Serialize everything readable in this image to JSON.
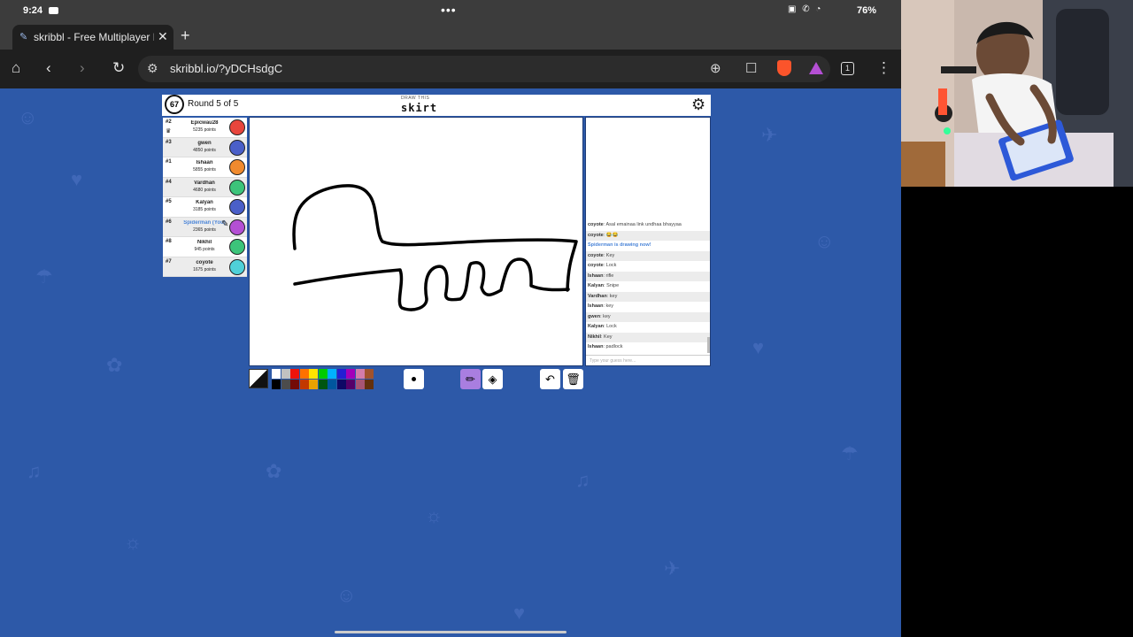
{
  "status": {
    "time": "9:24",
    "battery": "76%"
  },
  "browser": {
    "tab_title": "skribbl - Free Multiplayer Dra",
    "url": "skribbl.io/?yDCHsdgC",
    "tab_count": "1"
  },
  "game": {
    "timer": "67",
    "round": "Round 5 of 5",
    "draw_this": "DRAW THIS",
    "word": "skirt",
    "chat_placeholder": "Type your guess here...",
    "players": [
      {
        "rank": "#2",
        "name": "Epicwau28",
        "points": "5235 points",
        "avatar_color": "#e8453c",
        "crown": true,
        "highlight": false
      },
      {
        "rank": "#3",
        "name": "gwen",
        "points": "4850 points",
        "avatar_color": "#4a5fc8",
        "crown": false,
        "highlight": false
      },
      {
        "rank": "#1",
        "name": "Ishaan",
        "points": "5855 points",
        "avatar_color": "#f08a2e",
        "crown": false,
        "highlight": false
      },
      {
        "rank": "#4",
        "name": "Vardhan",
        "points": "4680 points",
        "avatar_color": "#3cc47a",
        "crown": false,
        "highlight": false
      },
      {
        "rank": "#5",
        "name": "Kalyan",
        "points": "3185 points",
        "avatar_color": "#4a5fc8",
        "crown": false,
        "highlight": false
      },
      {
        "rank": "#6",
        "name": "Spiderman (You)",
        "points": "2365 points",
        "avatar_color": "#b44fd4",
        "crown": false,
        "highlight": true,
        "drawing": true
      },
      {
        "rank": "#8",
        "name": "Nikhil",
        "points": "945 points",
        "avatar_color": "#3cc47a",
        "crown": false,
        "highlight": false
      },
      {
        "rank": "#7",
        "name": "coyote",
        "points": "1675 points",
        "avatar_color": "#4fd0d8",
        "crown": false,
        "highlight": false
      }
    ],
    "chat": [
      {
        "user": "coyote",
        "text": "Asal emainaa link undhaa bhayyaa"
      },
      {
        "user": "coyote",
        "text": "😂😂"
      },
      {
        "system": "Spiderman is drawing now!"
      },
      {
        "user": "coyote",
        "text": "Key"
      },
      {
        "user": "coyote",
        "text": "Lock"
      },
      {
        "user": "Ishaan",
        "text": "rifle"
      },
      {
        "user": "Kalyan",
        "text": "Snipe"
      },
      {
        "user": "Vardhan",
        "text": "key"
      },
      {
        "user": "Ishaan",
        "text": "key"
      },
      {
        "user": "gwen",
        "text": "key"
      },
      {
        "user": "Kalyan",
        "text": "Lock"
      },
      {
        "user": "Nikhil",
        "text": "Key"
      },
      {
        "user": "Ishaan",
        "text": "padlock"
      }
    ],
    "palette": [
      "#ffffff",
      "#c1c1c1",
      "#ef130b",
      "#ff7100",
      "#ffe400",
      "#00cc00",
      "#00b2ff",
      "#231fd3",
      "#a300ba",
      "#d37caa",
      "#a0522d",
      "#000000",
      "#4c4c4c",
      "#740b07",
      "#c23800",
      "#e8a200",
      "#005510",
      "#00569e",
      "#0e0865",
      "#550069",
      "#a75574",
      "#63300d"
    ]
  },
  "icons": {
    "home": "home-icon",
    "back": "back-icon",
    "forward": "forward-icon",
    "reload": "reload-icon",
    "zoom": "zoom-icon",
    "bookmark": "bookmark-icon",
    "settings": "gear-icon",
    "pencil": "pencil-icon",
    "fill": "fill-icon",
    "undo": "undo-icon",
    "trash": "trash-icon"
  }
}
